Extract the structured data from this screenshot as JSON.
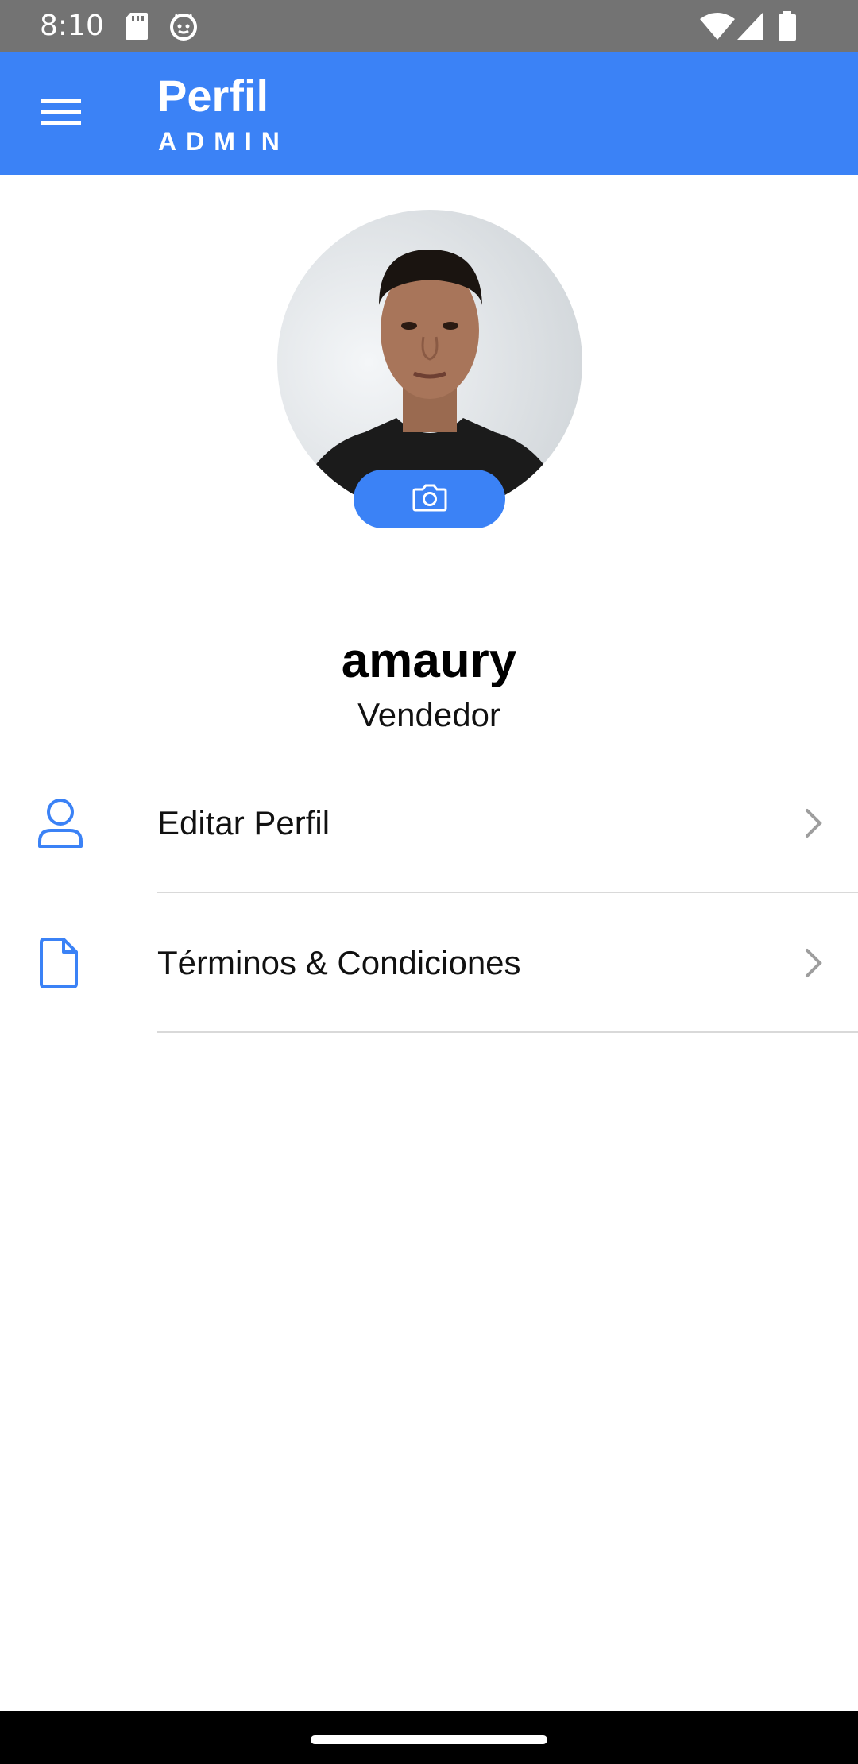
{
  "status_bar": {
    "time": "8:10",
    "icons": [
      "sd-card-icon",
      "cat-face-icon",
      "wifi-icon",
      "signal-icon",
      "battery-icon"
    ]
  },
  "app_bar": {
    "menu_icon": "hamburger-menu-icon",
    "title": "Perfil",
    "subtitle": "ADMIN"
  },
  "profile": {
    "avatar_icon": "profile-photo",
    "camera_icon": "camera-icon",
    "name": "amaury",
    "role": "Vendedor"
  },
  "menu": {
    "items": [
      {
        "label": "Editar Perfil",
        "icon": "user-icon"
      },
      {
        "label": "Términos & Condiciones",
        "icon": "document-icon"
      }
    ]
  },
  "colors": {
    "primary": "#3b82f6",
    "status_bar": "#737373",
    "divider": "#d9d9d9",
    "chevron": "#9e9e9e"
  }
}
